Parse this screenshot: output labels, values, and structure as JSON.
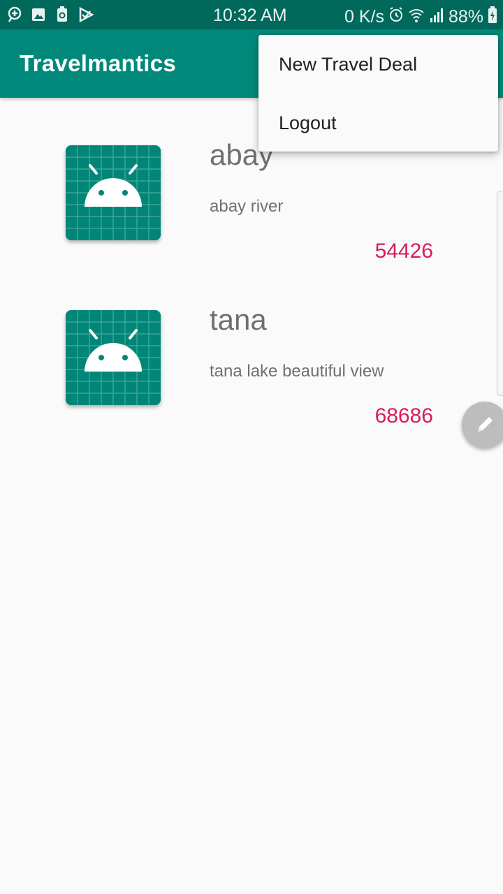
{
  "status_bar": {
    "time": "10:32 AM",
    "network_speed": "0 K/s",
    "battery": "88%",
    "left_icons": [
      "location-icon",
      "gallery-icon",
      "recycle-icon",
      "play-store-icon"
    ],
    "right_icons": [
      "alarm-icon",
      "wifi-icon",
      "signal-icon",
      "battery-icon"
    ]
  },
  "app_bar": {
    "title": "Travelmantics"
  },
  "overflow_menu": {
    "items": [
      {
        "label": "New Travel Deal"
      },
      {
        "label": "Logout"
      }
    ]
  },
  "deals": [
    {
      "title": "abay",
      "description": "abay river",
      "price": "54426",
      "image_icon": "android-placeholder-icon"
    },
    {
      "title": "tana",
      "description": "tana lake beautiful view",
      "price": "68686",
      "image_icon": "android-placeholder-icon"
    }
  ],
  "fab": {
    "icon": "edit-pencil-icon"
  },
  "colors": {
    "status_bar": "#00695c",
    "app_bar": "#00897b",
    "price": "#d81b60",
    "fab": "#bdbdbd"
  }
}
